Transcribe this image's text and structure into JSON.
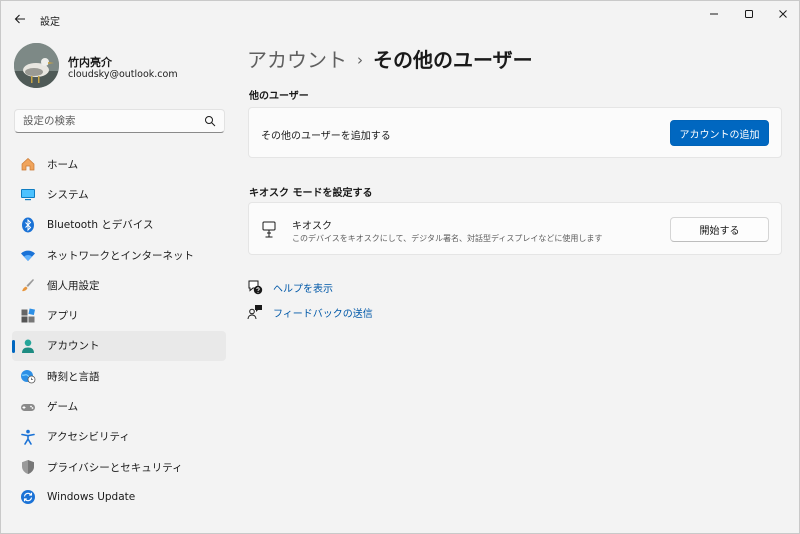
{
  "window": {
    "title": "設定",
    "back_icon": "arrow-left-icon",
    "minimize_icon": "minimize-icon",
    "maximize_icon": "maximize-icon",
    "close_icon": "close-icon"
  },
  "profile": {
    "name": "竹内亮介",
    "email": "cloudsky@outlook.com"
  },
  "search": {
    "placeholder": "設定の検索",
    "icon": "search-icon"
  },
  "nav": {
    "items": [
      {
        "label": "ホーム",
        "icon": "home-icon"
      },
      {
        "label": "システム",
        "icon": "system-icon"
      },
      {
        "label": "Bluetooth とデバイス",
        "icon": "bluetooth-icon"
      },
      {
        "label": "ネットワークとインターネット",
        "icon": "wifi-icon"
      },
      {
        "label": "個人用設定",
        "icon": "brush-icon"
      },
      {
        "label": "アプリ",
        "icon": "apps-icon"
      },
      {
        "label": "アカウント",
        "icon": "account-icon",
        "active": true
      },
      {
        "label": "時刻と言語",
        "icon": "globe-clock-icon"
      },
      {
        "label": "ゲーム",
        "icon": "gamepad-icon"
      },
      {
        "label": "アクセシビリティ",
        "icon": "accessibility-icon"
      },
      {
        "label": "プライバシーとセキュリティ",
        "icon": "shield-icon"
      },
      {
        "label": "Windows Update",
        "icon": "update-icon"
      }
    ]
  },
  "breadcrumb": {
    "parent": "アカウント",
    "separator": "›",
    "current": "その他のユーザー"
  },
  "other_users": {
    "section_title": "他のユーザー",
    "row_label": "その他のユーザーを追加する",
    "button_label": "アカウントの追加"
  },
  "kiosk": {
    "section_title": "キオスク モードを設定する",
    "title": "キオスク",
    "description": "このデバイスをキオスクにして、デジタル署名、対話型ディスプレイなどに使用します",
    "button_label": "開始する",
    "icon": "kiosk-icon"
  },
  "links": {
    "help": {
      "label": "ヘルプを表示",
      "icon": "help-icon"
    },
    "feedback": {
      "label": "フィードバックの送信",
      "icon": "feedback-icon"
    }
  },
  "colors": {
    "accent": "#0067c0",
    "background": "#f3f3f3",
    "card": "#fbfbfb",
    "link": "#0058a8"
  }
}
